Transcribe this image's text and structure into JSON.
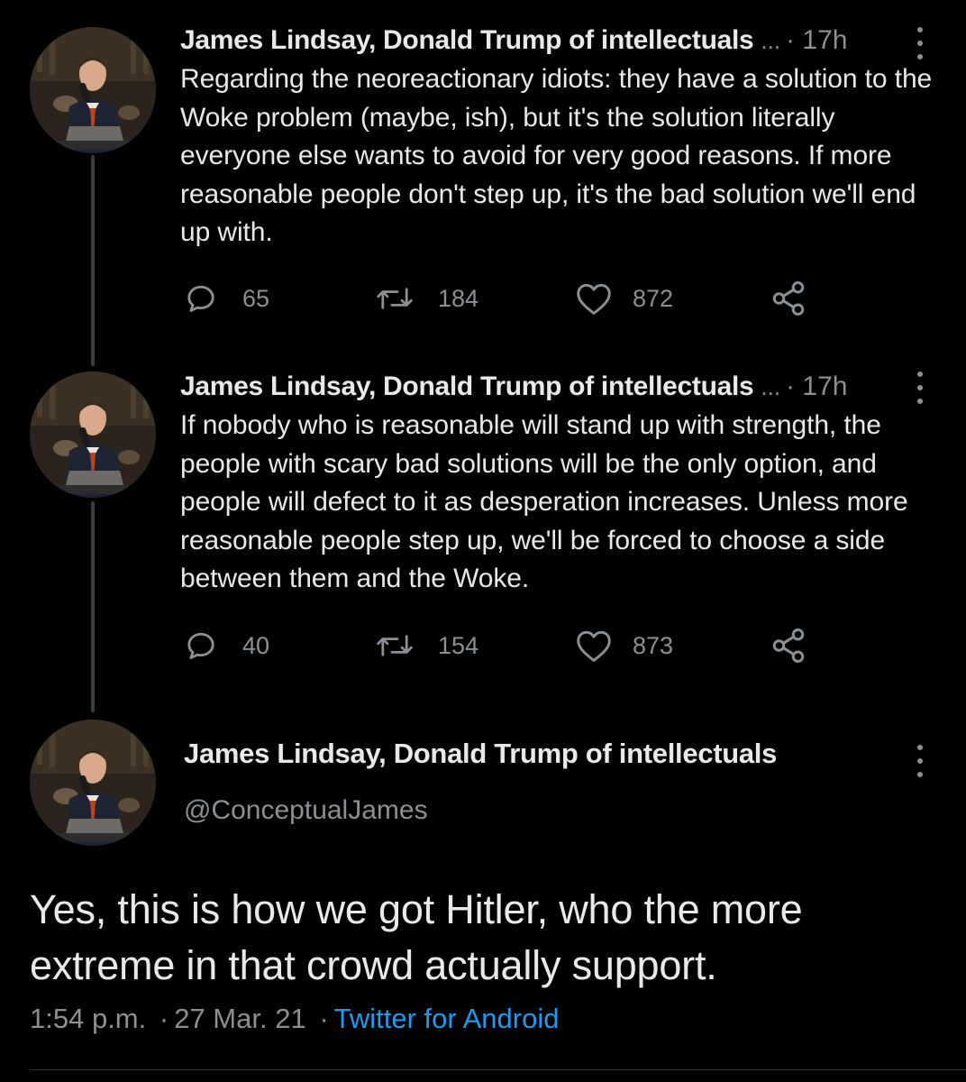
{
  "tweets": [
    {
      "author": "James Lindsay, Donald Trump of intellectuals",
      "ellipsis": "...",
      "time": "· 17h",
      "text": "Regarding the neoreactionary idiots: they have a solution to the Woke problem (maybe, ish), but it's the solution literally everyone else wants to avoid for very good reasons. If more reasonable people don't step up, it's the bad solution we'll end up with.",
      "replies": "65",
      "retweets": "184",
      "likes": "872"
    },
    {
      "author": "James Lindsay, Donald Trump of intellectuals",
      "ellipsis": "...",
      "time": "· 17h",
      "text": "If nobody who is reasonable will stand up with strength, the people with scary bad solutions will be the only option, and people will defect to it as desperation increases. Unless more reasonable people step up, we'll be forced to choose a side between them and the Woke.",
      "replies": "40",
      "retweets": "154",
      "likes": "873"
    }
  ],
  "main_tweet": {
    "author": "James Lindsay, Donald Trump of intellectuals",
    "handle": "@ConceptualJames",
    "text": "Yes, this is how we got Hitler, who the more extreme in that crowd actually support.",
    "time": "1:54 p.m.",
    "separator": "·",
    "date": "27 Mar. 21",
    "source": "Twitter for Android"
  },
  "icons": {
    "reply": "reply-icon",
    "retweet": "retweet-icon",
    "like": "heart-icon",
    "share": "share-icon",
    "more": "more-vertical-icon"
  },
  "colors": {
    "background": "#000000",
    "text": "#e7e9ea",
    "secondary": "#8b9095",
    "link": "#1d9bf0"
  }
}
